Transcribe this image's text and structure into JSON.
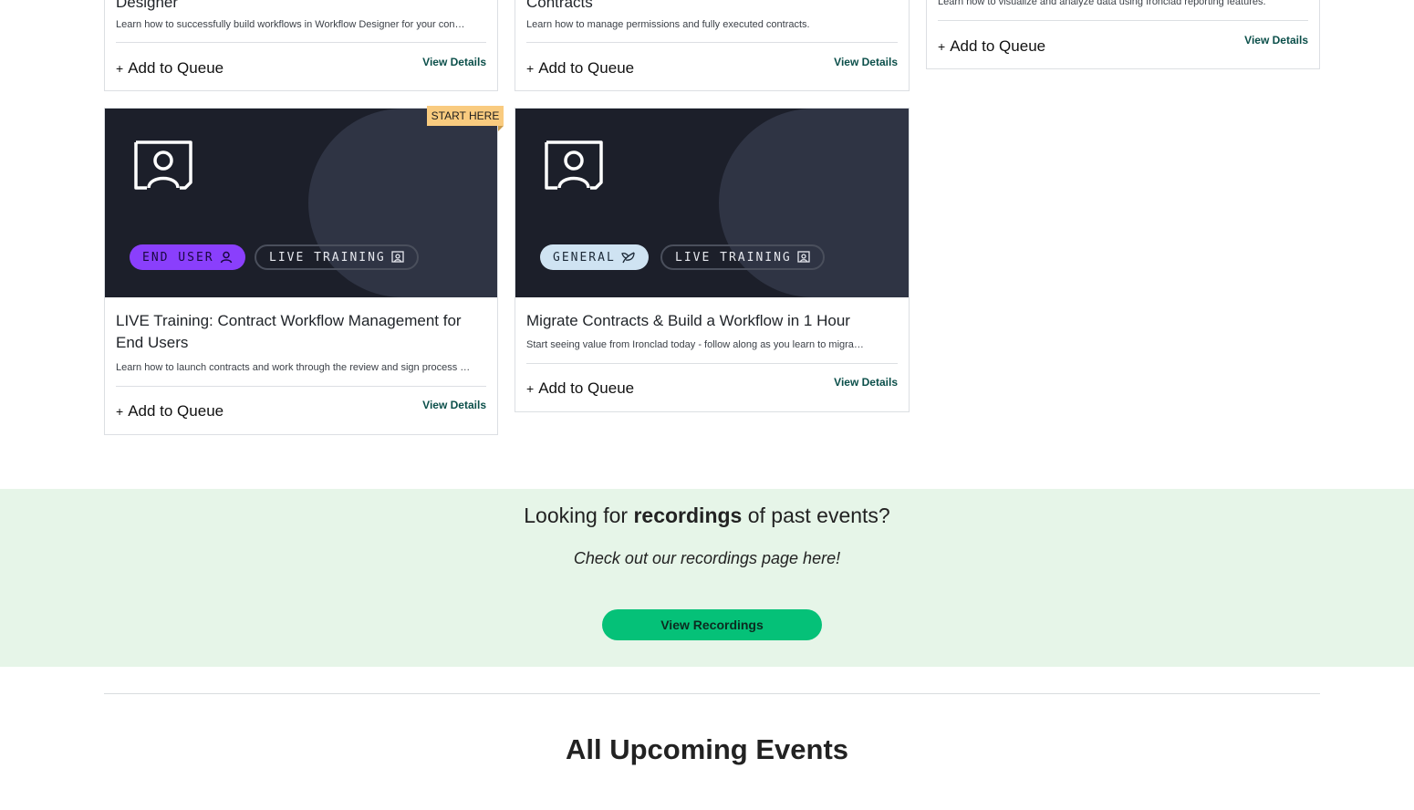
{
  "top_cards": [
    {
      "title_tail": "Designer",
      "desc": "Learn how to successfully build workflows in Workflow Designer for your con…",
      "queue": "Add to Queue",
      "details": "View Details"
    },
    {
      "title_tail": "Contracts",
      "desc": "Learn how to manage permissions and fully executed contracts.",
      "queue": "Add to Queue",
      "details": "View Details"
    },
    {
      "desc": "Learn how to visualize and analyze data using Ironclad reporting features.",
      "queue": "Add to Queue",
      "details": "View Details"
    }
  ],
  "cards": [
    {
      "ribbon": "START HERE",
      "chip1": "END USER",
      "chip2": "LIVE TRAINING",
      "title": "LIVE Training: Contract Workflow Management for End Users",
      "desc": "Learn how to launch contracts and work through the review and sign process …",
      "queue": "Add to Queue",
      "details": "View Details"
    },
    {
      "chip1": "GENERAL",
      "chip2": "LIVE TRAINING",
      "title": "Migrate Contracts & Build a Workflow in 1 Hour",
      "desc": "Start seeing value from Ironclad today - follow along as you learn to migra…",
      "queue": "Add to Queue",
      "details": "View Details"
    }
  ],
  "plus_glyph": "+",
  "promo": {
    "heading_pre": "Looking for ",
    "heading_bold": "recordings",
    "heading_post": " of past events?",
    "sub": "Check out our recordings page here!",
    "button": "View Recordings"
  },
  "section_title": "All Upcoming Events",
  "colors": {
    "end_user_chip": "#8a3ffc",
    "general_chip": "#cfe3f2",
    "ribbon": "#f9cb7f",
    "promo_bg": "#e6f5e8",
    "promo_button": "#05c178",
    "link": "#0b4f4a"
  },
  "icons": [
    "presenter-icon",
    "user-icon",
    "leaf-icon",
    "presentation-icon"
  ]
}
